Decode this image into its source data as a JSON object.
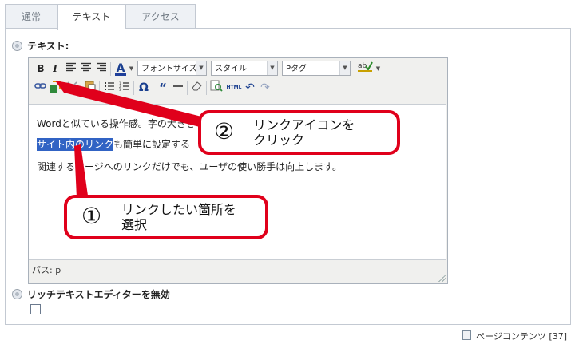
{
  "tabs": [
    {
      "label": "通常"
    },
    {
      "label": "テキスト"
    },
    {
      "label": "アクセス"
    }
  ],
  "text_section": {
    "title": "テキスト:"
  },
  "toolbar": {
    "bold": "B",
    "italic": "I",
    "font_size_select": "フォントサイズ",
    "style_select": "スタイル",
    "format_select": "Pタグ",
    "html_label": "HTML"
  },
  "editor": {
    "paragraphs": {
      "p1": "Wordと似ている操作感。字の大きさ",
      "p2_selected": "サイト内のリンク",
      "p2_rest": "も簡単に設定する",
      "p3": "関連するページへのリンクだけでも、ユーザの使い勝手は向上します。"
    },
    "status_path": "パス: p"
  },
  "rich_editor_section": {
    "title": "リッチテキストエディターを無効"
  },
  "callouts": [
    {
      "number": "①",
      "line1": "リンクしたい箇所を",
      "line2": "選択"
    },
    {
      "number": "②",
      "line1": "リンクアイコンを",
      "line2": "クリック"
    }
  ],
  "footer": {
    "label": "ページコンテンツ [37]"
  },
  "colors": {
    "callout": "#e0001b",
    "selection": "#3163c4",
    "border": "#c3c9d2"
  }
}
